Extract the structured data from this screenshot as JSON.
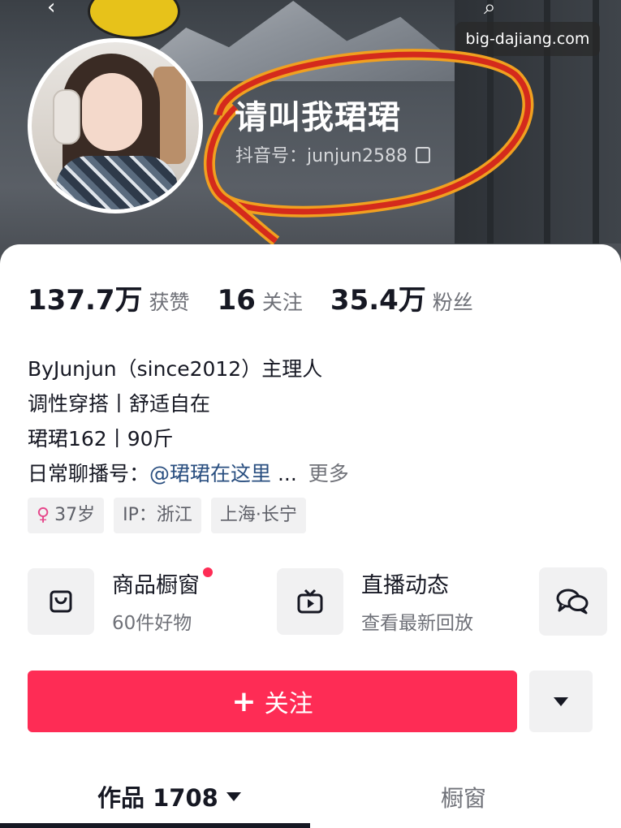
{
  "header": {
    "watermark": "big-dajiang.com",
    "profile_name": "请叫我珺珺",
    "douyin_id": "抖音号：junjun2588"
  },
  "stats": [
    {
      "value": "137.7万",
      "label": "获赞"
    },
    {
      "value": "16",
      "label": "关注"
    },
    {
      "value": "35.4万",
      "label": "粉丝"
    }
  ],
  "bio": {
    "line1": "ByJunjun（since2012）主理人",
    "line2": "调性穿搭丨舒适自在",
    "line3": "珺珺162丨90斤",
    "line4_prefix": "日常聊播号：",
    "line4_link": "@珺珺在这里",
    "line4_ellipsis": "...",
    "more": "更多"
  },
  "tags": [
    {
      "text": "37岁",
      "icon": "female-icon"
    },
    {
      "text": "IP：浙江"
    },
    {
      "text": "上海·长宁"
    }
  ],
  "features": {
    "shop": {
      "title": "商品橱窗",
      "subtitle": "60件好物",
      "icon": "shopping-bag-icon",
      "has_dot": true
    },
    "live": {
      "title": "直播动态",
      "subtitle": "查看最新回放",
      "icon": "tv-play-icon"
    },
    "chat_icon": "chat-bubbles-icon"
  },
  "actions": {
    "follow_plus": "+",
    "follow_label": "关注"
  },
  "tabs": {
    "works_label": "作品 1708",
    "showcase_label": "橱窗"
  },
  "colors": {
    "accent": "#fe2c55",
    "link": "#2a4f80",
    "annotation_red": "#d42a1c",
    "annotation_orange": "#f0a020"
  }
}
